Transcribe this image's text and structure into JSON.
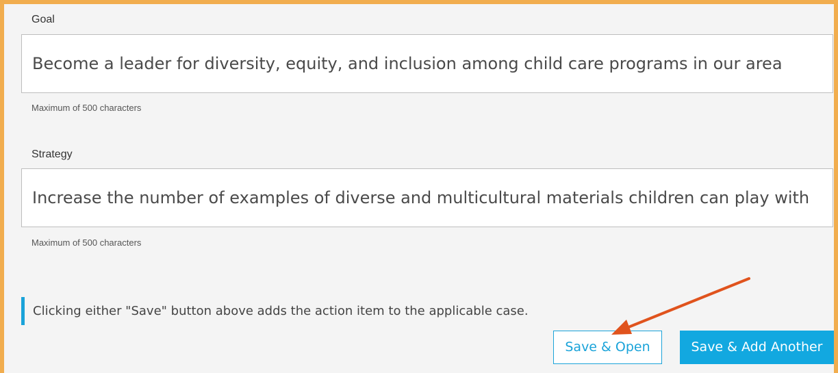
{
  "goal": {
    "label": "Goal",
    "value": "Become a leader for diversity, equity, and inclusion among child care programs in our area",
    "hint": "Maximum of 500 characters"
  },
  "strategy": {
    "label": "Strategy",
    "value": "Increase the number of examples of diverse and multicultural materials children can play with",
    "hint": "Maximum of 500 characters"
  },
  "notice": {
    "text": "Clicking either \"Save\" button above adds the action item to the applicable case."
  },
  "buttons": {
    "save_open": "Save & Open",
    "save_add_another": "Save & Add Another"
  },
  "colors": {
    "frame_border": "#f1ad4e",
    "accent": "#1aa3d9",
    "annotation_arrow": "#e0531d"
  },
  "icons": {
    "annotation": "arrow-pointer-icon"
  }
}
